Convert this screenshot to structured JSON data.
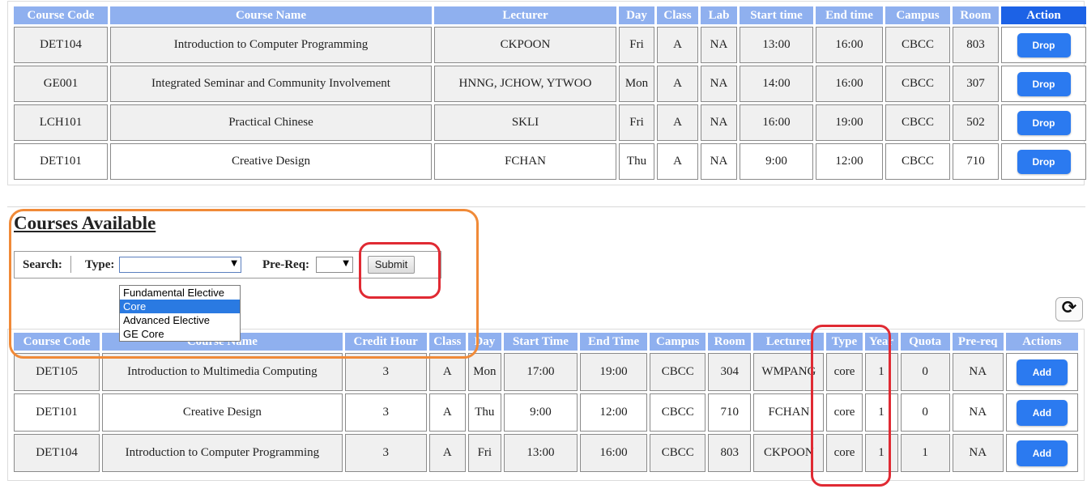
{
  "enrolled": {
    "headers": [
      "Course Code",
      "Course Name",
      "Lecturer",
      "Day",
      "Class",
      "Lab",
      "Start time",
      "End time",
      "Campus",
      "Room",
      "Action"
    ],
    "rows": [
      {
        "code": "DET104",
        "name": "Introduction to Computer Programming",
        "lecturer": "CKPOON",
        "day": "Fri",
        "class": "A",
        "lab": "NA",
        "start": "13:00",
        "end": "16:00",
        "campus": "CBCC",
        "room": "803",
        "action": "Drop"
      },
      {
        "code": "GE001",
        "name": "Integrated Seminar and Community Involvement",
        "lecturer": "HNNG, JCHOW, YTWOO",
        "day": "Mon",
        "class": "A",
        "lab": "NA",
        "start": "14:00",
        "end": "16:00",
        "campus": "CBCC",
        "room": "307",
        "action": "Drop"
      },
      {
        "code": "LCH101",
        "name": "Practical Chinese",
        "lecturer": "SKLI",
        "day": "Fri",
        "class": "A",
        "lab": "NA",
        "start": "16:00",
        "end": "19:00",
        "campus": "CBCC",
        "room": "502",
        "action": "Drop"
      },
      {
        "code": "DET101",
        "name": "Creative Design",
        "lecturer": "FCHAN",
        "day": "Thu",
        "class": "A",
        "lab": "NA",
        "start": "9:00",
        "end": "12:00",
        "campus": "CBCC",
        "room": "710",
        "action": "Drop"
      }
    ]
  },
  "available": {
    "title": "Courses Available",
    "search": {
      "label": "Search:",
      "type_label": "Type:",
      "type_value": "",
      "type_options": [
        "Fundamental Elective",
        "Core",
        "Advanced Elective",
        "GE Core"
      ],
      "type_selected_index": 1,
      "prereq_label": "Pre-Req:",
      "prereq_value": "",
      "submit_label": "Submit"
    },
    "headers": [
      "Course Code",
      "Course Name",
      "Credit Hour",
      "Class",
      "Day",
      "Start Time",
      "End Time",
      "Campus",
      "Room",
      "Lecturer",
      "Type",
      "Year",
      "Quota",
      "Pre-req",
      "Actions"
    ],
    "rows": [
      {
        "code": "DET105",
        "name": "Introduction to Multimedia Computing",
        "credit": "3",
        "class": "A",
        "day": "Mon",
        "start": "17:00",
        "end": "19:00",
        "campus": "CBCC",
        "room": "304",
        "lecturer": "WMPANG",
        "type": "core",
        "year": "1",
        "quota": "0",
        "prereq": "NA",
        "action": "Add"
      },
      {
        "code": "DET101",
        "name": "Creative Design",
        "credit": "3",
        "class": "A",
        "day": "Thu",
        "start": "9:00",
        "end": "12:00",
        "campus": "CBCC",
        "room": "710",
        "lecturer": "FCHAN",
        "type": "core",
        "year": "1",
        "quota": "0",
        "prereq": "NA",
        "action": "Add"
      },
      {
        "code": "DET104",
        "name": "Introduction to Computer Programming",
        "credit": "3",
        "class": "A",
        "day": "Fri",
        "start": "13:00",
        "end": "16:00",
        "campus": "CBCC",
        "room": "803",
        "lecturer": "CKPOON",
        "type": "core",
        "year": "1",
        "quota": "1",
        "prereq": "NA",
        "action": "Add"
      }
    ]
  },
  "icons": {
    "refresh": "refresh-icon",
    "caret": "chevron-down-icon"
  },
  "colors": {
    "header": "#8fb0ef",
    "action_header": "#1c62e6",
    "button": "#2b7af0",
    "orange_highlight": "#f08a38",
    "red_highlight": "#e02a33"
  }
}
